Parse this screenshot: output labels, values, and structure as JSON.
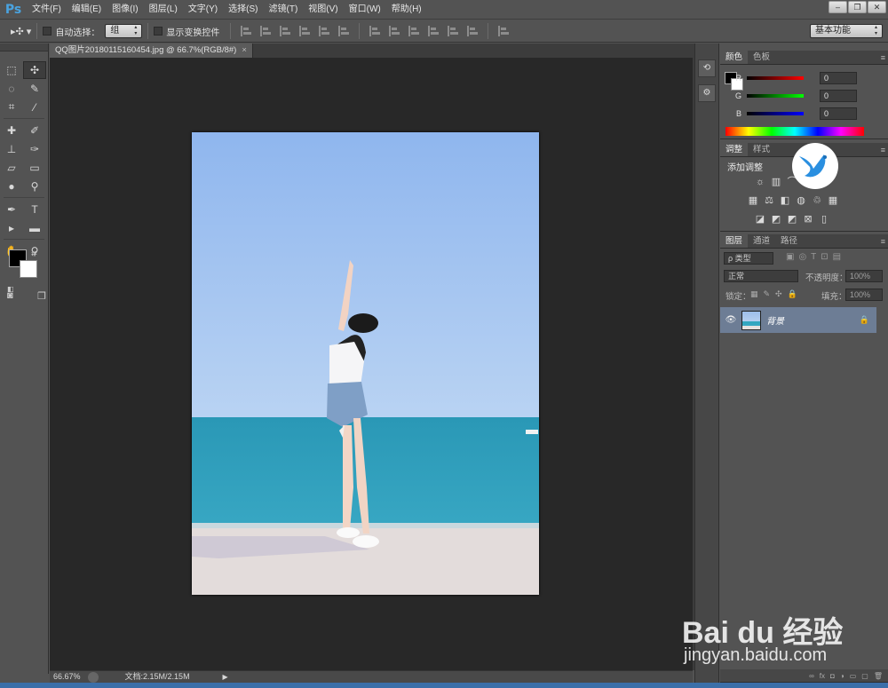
{
  "app": {
    "logo": "Ps"
  },
  "menubar": {
    "items": [
      "文件(F)",
      "编辑(E)",
      "图像(I)",
      "图层(L)",
      "文字(Y)",
      "选择(S)",
      "滤镜(T)",
      "视图(V)",
      "窗口(W)",
      "帮助(H)"
    ],
    "window_buttons": [
      "minimize",
      "restore",
      "close"
    ]
  },
  "options": {
    "auto_select_label": "自动选择：",
    "auto_select_value": "组",
    "show_transform_label": "显示变换控件",
    "workspace": "基本功能"
  },
  "document": {
    "tab_title": "QQ图片20180115160454.jpg @ 66.7%(RGB/8#)",
    "close_glyph": "×",
    "zoom": "66.67%",
    "doc_size": "文档:2.15M/2.15M"
  },
  "color_panel": {
    "tabs": [
      "颜色",
      "色板"
    ],
    "channels": [
      {
        "label": "R",
        "value": "0"
      },
      {
        "label": "G",
        "value": "0"
      },
      {
        "label": "B",
        "value": "0"
      }
    ]
  },
  "adjust_panel": {
    "tabs": [
      "调整",
      "样式"
    ],
    "title": "添加调整"
  },
  "layers_panel": {
    "tabs": [
      "图层",
      "通道",
      "路径"
    ],
    "kind_filter": "ρ 类型",
    "blend_mode": "正常",
    "opacity_label": "不透明度：",
    "opacity_value": "100%",
    "lock_label": "锁定：",
    "fill_label": "填充：",
    "fill_value": "100%",
    "layers": [
      {
        "name": "背景",
        "visible": true,
        "locked": true
      }
    ]
  },
  "watermark": {
    "brand": "Bai du 经验",
    "url": "jingyan.baidu.com"
  },
  "colors": {
    "foreground": "#000000",
    "background": "#ffffff",
    "layer_selected": "#6d7d95"
  },
  "icons": {
    "tools": [
      "marquee-icon",
      "move-icon",
      "lasso-icon",
      "quick-select-icon",
      "crop-icon",
      "eyedropper-icon",
      "healing-icon",
      "brush-icon",
      "stamp-icon",
      "history-brush-icon",
      "eraser-icon",
      "gradient-icon",
      "blur-icon",
      "dodge-icon",
      "pen-icon",
      "type-icon",
      "path-select-icon",
      "rectangle-icon",
      "hand-icon",
      "zoom-icon"
    ]
  }
}
